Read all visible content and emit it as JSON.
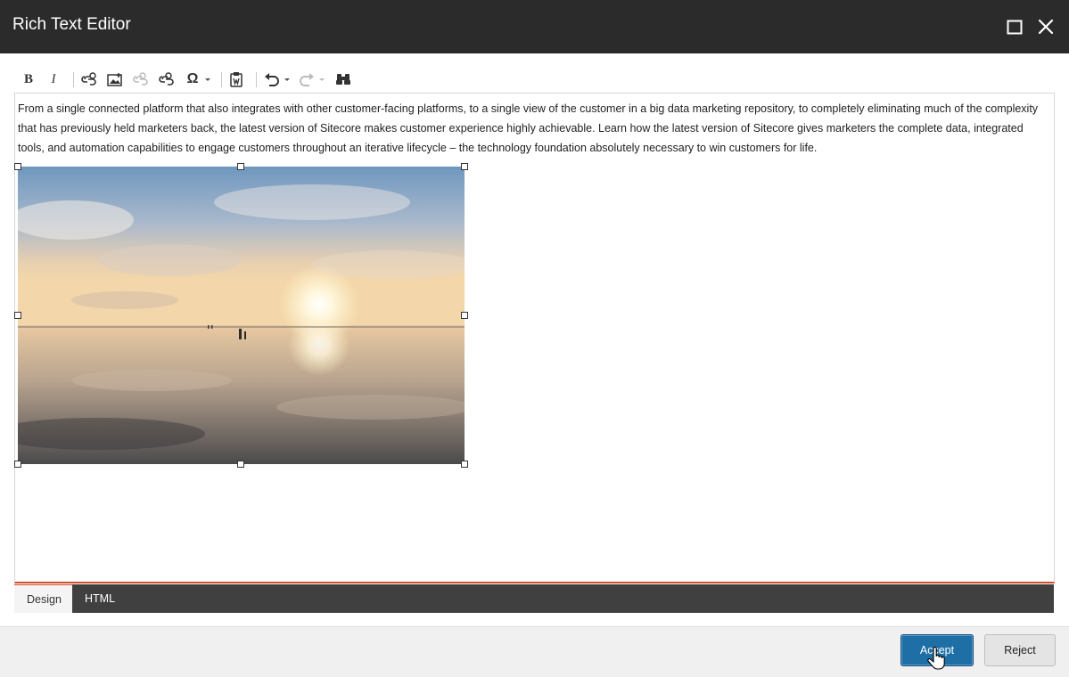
{
  "window": {
    "title": "Rich Text Editor",
    "maximize_icon": "maximize-icon",
    "close_icon": "close-icon"
  },
  "toolbar": {
    "items": [
      {
        "name": "bold",
        "label": "B"
      },
      {
        "name": "italic",
        "label": "I"
      },
      {
        "name": "insert-link",
        "icon": "link-icon"
      },
      {
        "name": "insert-media",
        "icon": "image-icon"
      },
      {
        "name": "remove-link",
        "icon": "unlink-icon"
      },
      {
        "name": "insert-link-2",
        "icon": "link-icon"
      },
      {
        "name": "special-characters",
        "label": "Ω"
      },
      {
        "name": "paste-from-word",
        "icon": "paste-word-icon"
      },
      {
        "name": "undo",
        "icon": "undo-icon"
      },
      {
        "name": "redo",
        "icon": "redo-icon"
      },
      {
        "name": "find-replace",
        "icon": "binoculars-icon"
      }
    ]
  },
  "content": {
    "paragraph": "From a single connected platform that also integrates with other customer-facing platforms, to a single view of the customer in a big data marketing repository, to completely eliminating much of the complexity that has previously held marketers back, the latest version of Sitecore makes customer experience highly achievable. Learn how the latest version of Sitecore gives marketers the complete data, integrated tools, and automation capabilities to engage customers throughout an iterative lifecycle – the technology foundation absolutely necessary to win customers for life.",
    "image": "sunset-over-reflective-beach-photo"
  },
  "modes": {
    "design": "Design",
    "html": "HTML"
  },
  "footer": {
    "accept": "Accept",
    "reject": "Reject"
  },
  "colors": {
    "titlebar": "#2b2b2b",
    "accent": "#d04a2c",
    "accept": "#1f6fa7"
  }
}
